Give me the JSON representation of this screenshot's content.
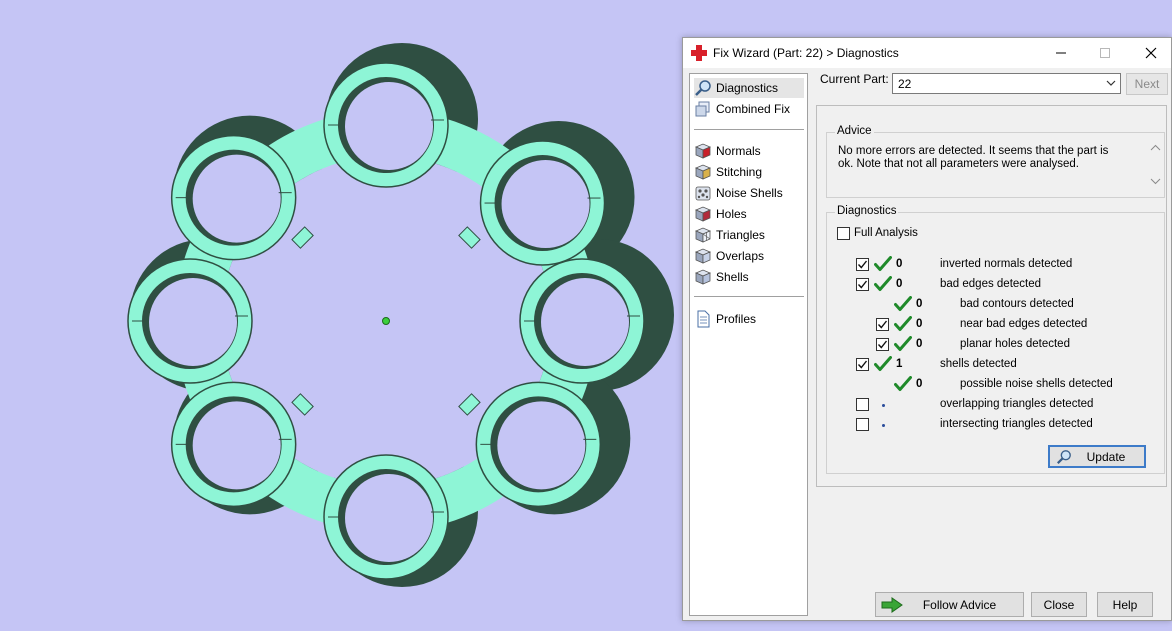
{
  "dialog": {
    "title": "Fix Wizard (Part: 22) > Diagnostics",
    "nav": [
      {
        "label": "Diagnostics",
        "icon": "magnifier-icon",
        "selected": true
      },
      {
        "label": "Combined Fix",
        "icon": "combined-fix-icon"
      },
      {
        "label": "Normals",
        "icon": "normals-cube-icon"
      },
      {
        "label": "Stitching",
        "icon": "stitching-icon"
      },
      {
        "label": "Noise Shells",
        "icon": "noise-shells-icon"
      },
      {
        "label": "Holes",
        "icon": "holes-icon"
      },
      {
        "label": "Triangles",
        "icon": "triangles-icon"
      },
      {
        "label": "Overlaps",
        "icon": "overlaps-icon"
      },
      {
        "label": "Shells",
        "icon": "shells-icon"
      },
      {
        "label": "Profiles",
        "icon": "profiles-document-icon"
      }
    ],
    "current_part_label": "Current Part:",
    "current_part_value": "22",
    "next_label": "Next",
    "advice": {
      "title": "Advice",
      "text": "No more errors are detected. It seems that the part is ok. Note that not all parameters were analysed."
    },
    "diagnostics": {
      "title": "Diagnostics",
      "full_analysis_label": "Full Analysis",
      "rows": [
        {
          "checkbox": true,
          "checked": true,
          "status": "ok",
          "value": "0",
          "label": "inverted normals detected"
        },
        {
          "checkbox": true,
          "checked": true,
          "status": "ok",
          "value": "0",
          "label": "bad edges detected"
        },
        {
          "checkbox": false,
          "status": "ok",
          "value": "0",
          "label": "bad contours detected"
        },
        {
          "checkbox": true,
          "checked": true,
          "status": "ok",
          "value": "0",
          "label": "near bad edges detected"
        },
        {
          "checkbox": true,
          "checked": true,
          "status": "ok",
          "value": "0",
          "label": "planar holes detected"
        },
        {
          "checkbox": true,
          "checked": true,
          "status": "ok",
          "value": "1",
          "label": "shells detected"
        },
        {
          "checkbox": false,
          "status": "ok",
          "value": "0",
          "label": "possible noise shells detected"
        },
        {
          "checkbox": true,
          "checked": false,
          "status": "pending",
          "value": "",
          "label": "overlapping triangles detected"
        },
        {
          "checkbox": true,
          "checked": false,
          "status": "pending",
          "value": "",
          "label": "intersecting triangles detected"
        }
      ],
      "update_label": "Update"
    },
    "buttons": {
      "follow_advice": "Follow Advice",
      "close": "Close",
      "help": "Help"
    }
  },
  "colors": {
    "background": "#c5c5f5",
    "part_face": "#8ef5d6",
    "part_shadow": "#2f4f42",
    "check_green": "#1f8a2a"
  }
}
